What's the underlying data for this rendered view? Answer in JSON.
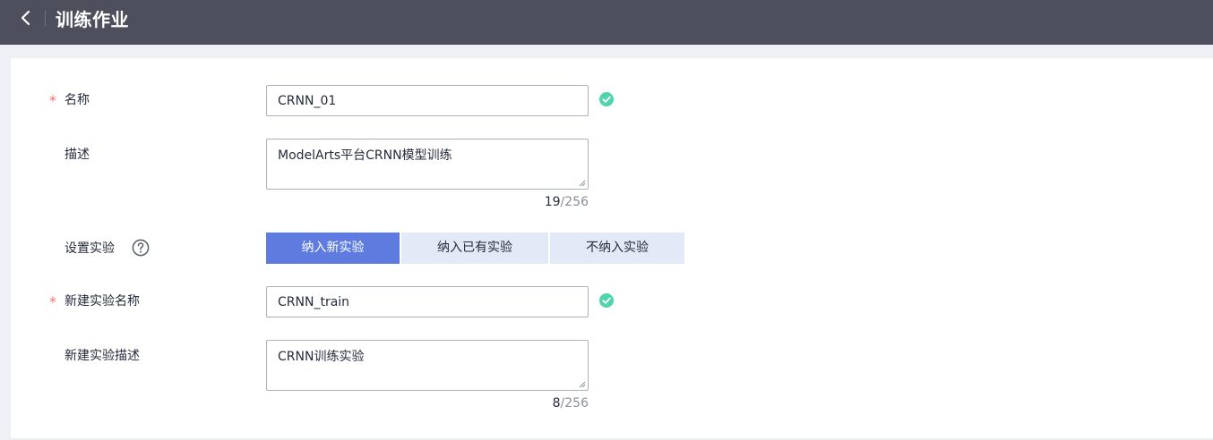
{
  "header": {
    "title": "训练作业",
    "back_icon": "chevron-left-icon"
  },
  "form": {
    "name": {
      "label": "名称",
      "required_mark": "*",
      "value": "CRNN_01",
      "valid": true
    },
    "description": {
      "label": "描述",
      "value": "ModelArts平台CRNN模型训练",
      "count": "19",
      "max": "/256"
    },
    "experiment": {
      "label": "设置实验",
      "help_icon": "question-circle-icon",
      "options": [
        "纳入新实验",
        "纳入已有实验",
        "不纳入实验"
      ],
      "selected": "纳入新实验"
    },
    "new_exp_name": {
      "label": "新建实验名称",
      "required_mark": "*",
      "value": "CRNN_train",
      "valid": true
    },
    "new_exp_desc": {
      "label": "新建实验描述",
      "value": "CRNN训练实验",
      "count": "8",
      "max": "/256"
    }
  },
  "colors": {
    "header_bg": "#4d505c",
    "primary": "#5e7ce0",
    "segment_bg": "#e4e9f7",
    "success": "#50d4ab",
    "required": "#f66f6a"
  }
}
